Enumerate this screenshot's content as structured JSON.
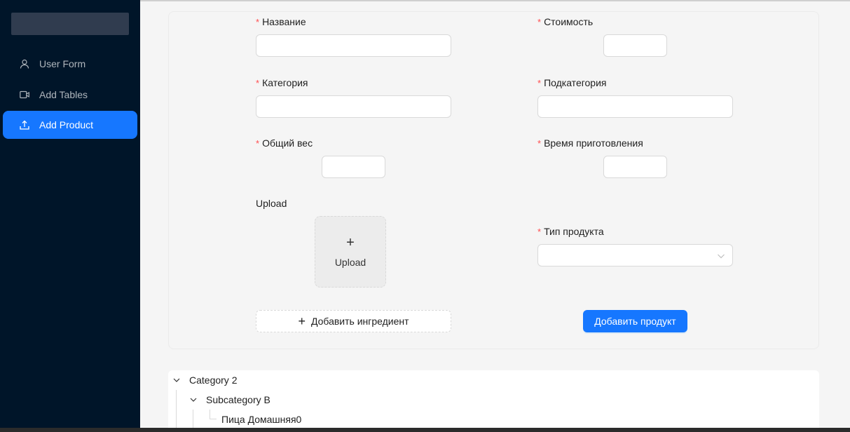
{
  "sidebar": {
    "items": [
      {
        "label": "User Form",
        "icon": "user-icon"
      },
      {
        "label": "Add Tables",
        "icon": "video-camera-icon"
      },
      {
        "label": "Add Product",
        "icon": "upload-icon",
        "active": true
      }
    ]
  },
  "form": {
    "name_label": "Название",
    "cost_label": "Стоимость",
    "category_label": "Категория",
    "subcategory_label": "Подкатегория",
    "weight_label": "Общий вес",
    "cook_time_label": "Время приготовления",
    "upload_label": "Upload",
    "upload_button_text": "Upload",
    "upload_plus": "+",
    "product_type_label": "Тип продукта",
    "add_ingredient_label": "Добавить ингредиент",
    "add_ingredient_plus": "+",
    "submit_label": "Добавить продукт",
    "required_mark": "*",
    "name_value": "",
    "cost_value": "",
    "category_value": "",
    "subcategory_value": "",
    "weight_value": "",
    "cook_time_value": "",
    "product_type_value": ""
  },
  "tree": {
    "nodes": [
      {
        "title": "Category 2",
        "level": 0,
        "expanded": true
      },
      {
        "title": "Subcategory B",
        "level": 1,
        "expanded": true
      },
      {
        "title": "Пица Домашняя0",
        "level": 2,
        "leaf": true
      }
    ]
  },
  "colors": {
    "sidebar_bg": "#001529",
    "accent": "#1677ff",
    "required": "#ff4d4f"
  }
}
